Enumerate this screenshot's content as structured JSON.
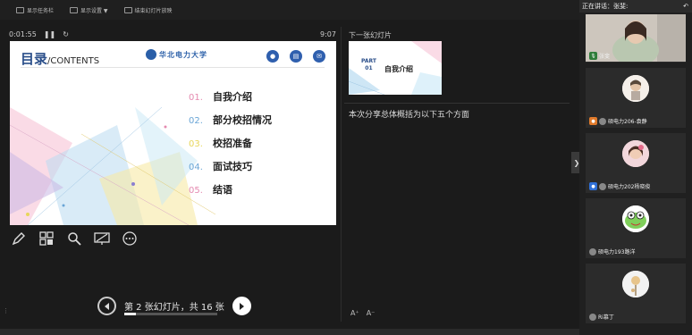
{
  "toolbar": {
    "show_taskbar": "显示任务栏",
    "display_settings": "显示设置 ▼",
    "end_show": "结束幻灯片放映"
  },
  "timer": {
    "elapsed": "0:01:55",
    "clock": "9:07"
  },
  "current_slide": {
    "title_cn": "目录",
    "title_en": "/CONTENTS",
    "logo_text": "华北电力大学",
    "items": [
      {
        "num": "01.",
        "text": "自我介绍",
        "color": "#e58ab0"
      },
      {
        "num": "02.",
        "text": "部分校招情况",
        "color": "#6aa5d6"
      },
      {
        "num": "03.",
        "text": "校招准备",
        "color": "#e8d65a"
      },
      {
        "num": "04.",
        "text": "面试技巧",
        "color": "#6aa5d6"
      },
      {
        "num": "05.",
        "text": "结语",
        "color": "#e58ab0"
      }
    ]
  },
  "next": {
    "label": "下一张幻灯片",
    "part": "PART",
    "part_num": "01",
    "title": "自我介绍"
  },
  "notes": "本次分享总体概括为以下五个方面",
  "font_controls": {
    "increase": "A⁺",
    "decrease": "A⁻"
  },
  "navigation": {
    "counter": "第 2 张幻灯片，共 16 张",
    "progress": 0.125
  },
  "panel": {
    "speaker_prefix": "正在讲话：",
    "speaker_name": "张斐:",
    "participants": [
      {
        "name": "张斐"
      },
      {
        "name": "硕电力206-袁静"
      },
      {
        "name": "硕电力202杨晓俊"
      },
      {
        "name": "硕电力193路洋"
      },
      {
        "name": "Ri慕丁"
      }
    ]
  }
}
